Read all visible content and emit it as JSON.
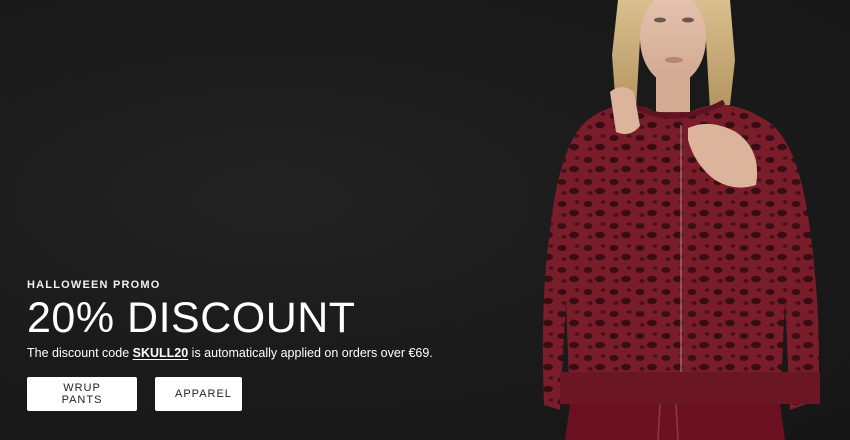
{
  "promo": {
    "eyebrow": "HALLOWEEN PROMO",
    "headline": "20% DISCOUNT",
    "desc_before": "The discount code ",
    "code": "SKULL20",
    "desc_after": " is automatically applied on orders over €69."
  },
  "buttons": {
    "primary_label": "WRUP PANTS",
    "secondary_label": "APPAREL"
  },
  "colors": {
    "background": "#1a1a1a",
    "hoodie": "#7a1d2a",
    "button_bg": "#ffffff",
    "button_text": "#222222"
  }
}
